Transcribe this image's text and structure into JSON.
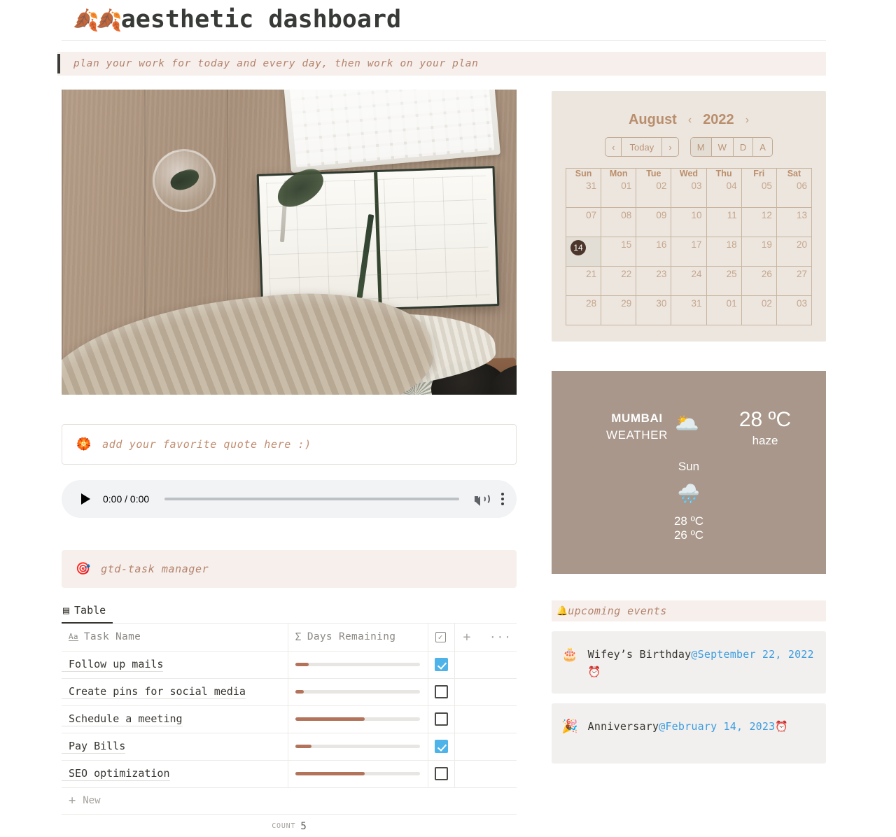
{
  "header": {
    "leaf_icon": "🍂🍂",
    "title": "aesthetic dashboard"
  },
  "quote_banner": {
    "text": "plan your work for today and every day, then work on your plan"
  },
  "quote_input": {
    "icon": "🏵️",
    "placeholder": "add your favorite quote here :)"
  },
  "audio": {
    "time": "0:00 / 0:00"
  },
  "gtd": {
    "icon": "🎯",
    "label": "gtd-task manager"
  },
  "table": {
    "tab_icon": "▤",
    "tab_label": "Table",
    "columns": {
      "name_icon": "Aa",
      "name": "Task Name",
      "days_icon": "Σ",
      "days": "Days Remaining",
      "check_icon": "✓",
      "plus": "+",
      "dots": "···"
    },
    "rows": [
      {
        "name": "Follow up mails",
        "progress": 11,
        "done": true
      },
      {
        "name": "Create pins for social media",
        "progress": 7,
        "done": false
      },
      {
        "name": "Schedule a meeting",
        "progress": 56,
        "done": false
      },
      {
        "name": "Pay Bills",
        "progress": 13,
        "done": true
      },
      {
        "name": "SEO optimization",
        "progress": 56,
        "done": false
      }
    ],
    "new_label": "New",
    "count_label": "COUNT",
    "count_value": "5"
  },
  "calendar": {
    "month": "August",
    "year": "2022",
    "prev_arrow": "‹",
    "next_arrow": "›",
    "today_label": "Today",
    "prev_btn": "‹",
    "next_btn": "›",
    "views": [
      "M",
      "W",
      "D",
      "A"
    ],
    "selected_view": "M",
    "weekdays": [
      "Sun",
      "Mon",
      "Tue",
      "Wed",
      "Thu",
      "Fri",
      "Sat"
    ],
    "weeks": [
      [
        "31",
        "01",
        "02",
        "03",
        "04",
        "05",
        "06"
      ],
      [
        "07",
        "08",
        "09",
        "10",
        "11",
        "12",
        "13"
      ],
      [
        "14",
        "15",
        "16",
        "17",
        "18",
        "19",
        "20"
      ],
      [
        "21",
        "22",
        "23",
        "24",
        "25",
        "26",
        "27"
      ],
      [
        "28",
        "29",
        "30",
        "31",
        "01",
        "02",
        "03"
      ]
    ],
    "today_date": "14",
    "accent_color": "#b98e6d",
    "background_color": "#ece6de"
  },
  "weather": {
    "city": "MUMBAI",
    "label": "WEATHER",
    "current_icon": "🌥️",
    "temperature": "28 ºC",
    "condition": "haze",
    "forecast_day": "Sun",
    "forecast_icon": "🌧️",
    "forecast_high": "28 ºC",
    "forecast_low": "26 ºC",
    "background_color": "#a8978a"
  },
  "events": {
    "bell_icon": "🔔",
    "heading": "upcoming events",
    "items": [
      {
        "emoji": "🎂",
        "title": "Wifey’s Birthday",
        "date": "@September 22, 2022",
        "alarm": "⏰"
      },
      {
        "emoji": "🎉",
        "title": "Anniversary",
        "date": "@February 14, 2023",
        "alarm": "⏰"
      }
    ]
  }
}
